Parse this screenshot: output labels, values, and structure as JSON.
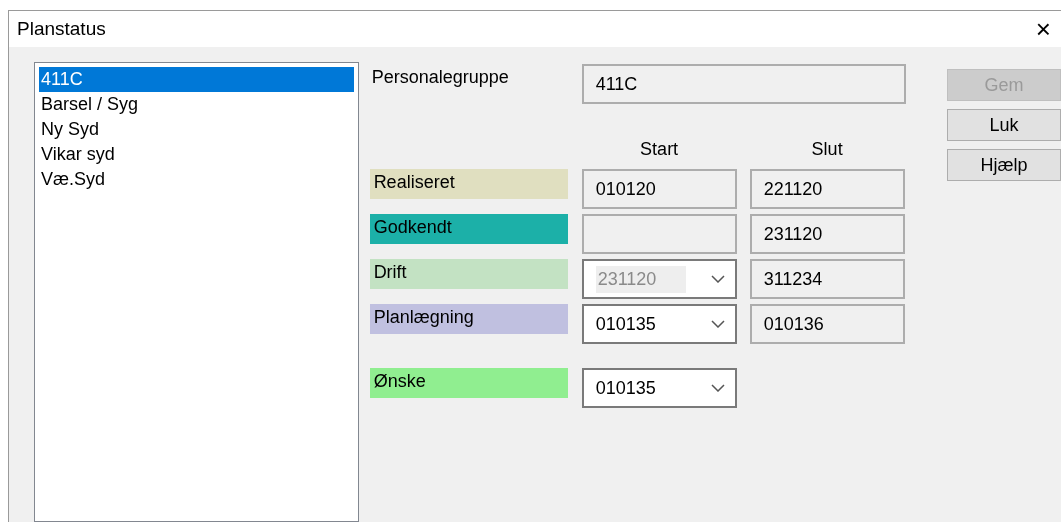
{
  "window": {
    "title": "Planstatus",
    "close": "×"
  },
  "list": {
    "items": [
      {
        "label": "411C",
        "selected": true
      },
      {
        "label": "Barsel / Syg",
        "selected": false
      },
      {
        "label": "Ny Syd",
        "selected": false
      },
      {
        "label": "Vikar syd",
        "selected": false
      },
      {
        "label": "Væ.Syd",
        "selected": false
      }
    ]
  },
  "group": {
    "label": "Personalegruppe",
    "value": "411C"
  },
  "columns": [
    "Start",
    "Slut"
  ],
  "rows": [
    {
      "label": "Realiseret",
      "color": "#e0dfc0",
      "start": {
        "kind": "text",
        "value": "010120"
      },
      "end": {
        "kind": "text",
        "value": "221120"
      }
    },
    {
      "label": "Godkendt",
      "color": "#1cb0a8",
      "start": {
        "kind": "text"
      },
      "end": {
        "kind": "text",
        "value": "231120"
      }
    },
    {
      "label": "Drift",
      "color": "#c3e2c3",
      "start": {
        "kind": "dropdown",
        "value": "231120",
        "disabled": true
      },
      "end": {
        "kind": "text",
        "value": "311234"
      }
    },
    {
      "label": "Planlægning",
      "color": "#c0c0e0",
      "start": {
        "kind": "dropdown",
        "value": "010135",
        "disabled": false
      },
      "end": {
        "kind": "text",
        "value": "010136"
      }
    },
    {
      "label": "Ønske",
      "color": "#90ee90",
      "start": {
        "kind": "dropdown",
        "value": "010135",
        "disabled": false
      }
    }
  ],
  "buttons": [
    {
      "label": "Gem",
      "disabled": true
    },
    {
      "label": "Luk",
      "disabled": false
    },
    {
      "label": "Hjælp",
      "disabled": false
    }
  ]
}
